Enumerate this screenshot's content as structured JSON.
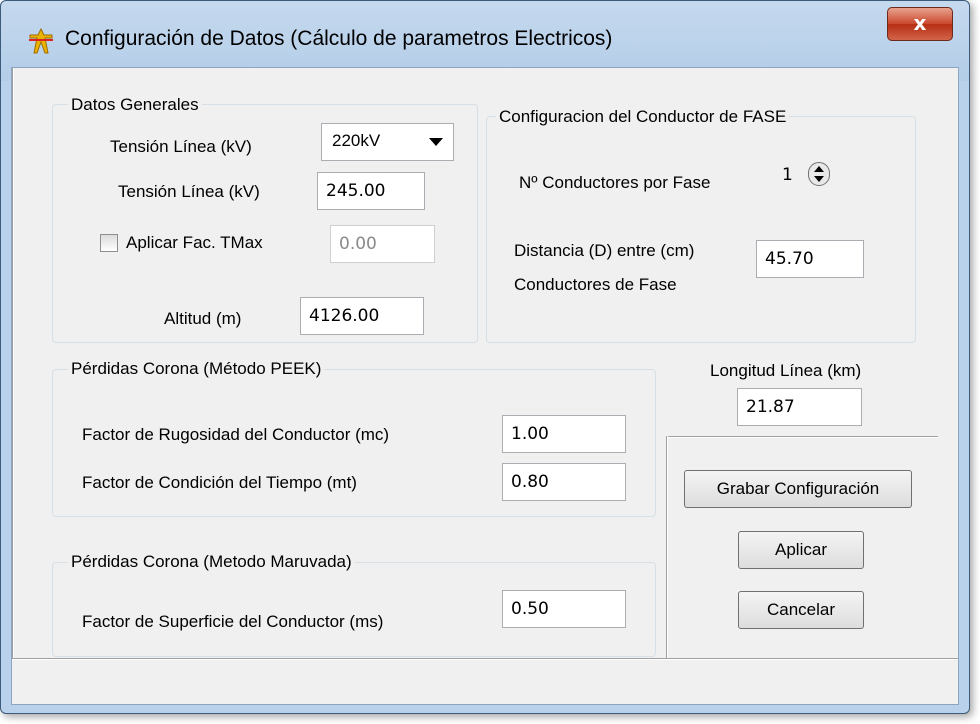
{
  "window": {
    "title": "Configuración de Datos (Cálculo de parametros Electricos)",
    "close_label": "x"
  },
  "datos_generales": {
    "title": "Datos Generales",
    "tension_label": "Tensión Línea (kV)",
    "tension_combo_value": "220kV",
    "tension_value_label": "Tensión Línea (kV)",
    "tension_value": "245.00",
    "aplicar_tmax_label": "Aplicar Fac. TMax",
    "aplicar_tmax_checked": false,
    "tmax_value": "0.00",
    "altitud_label": "Altitud (m)",
    "altitud_value": "4126.00"
  },
  "conductor_fase": {
    "title": "Configuracion del Conductor de FASE",
    "n_conductores_label": "Nº Conductores por Fase",
    "n_conductores_value": "1",
    "distancia_label": "Distancia (D)  entre (cm)",
    "distancia_label2": "Conductores de Fase",
    "distancia_value": "45.70"
  },
  "peek": {
    "title": "Pérdidas Corona (Método PEEK)",
    "rugosidad_label": "Factor de Rugosidad del Conductor (mc)",
    "rugosidad_value": "1.00",
    "tiempo_label": "Factor de Condición del Tiempo (mt)",
    "tiempo_value": "0.80"
  },
  "maruvada": {
    "title": "Pérdidas Corona (Metodo Maruvada)",
    "superficie_label": "Factor de Superficie del Conductor (ms)",
    "superficie_value": "0.50"
  },
  "longitud": {
    "label": "Longitud Línea (km)",
    "value": "21.87"
  },
  "buttons": {
    "grabar": "Grabar Configuración",
    "aplicar": "Aplicar",
    "cancelar": "Cancelar"
  },
  "icons": {
    "app_icon": "transmission-tower-icon",
    "close_icon": "close-icon"
  },
  "colors": {
    "titlebar": "#b9d1ea",
    "close_button": "#c9472b",
    "client_background": "#f0f0f0",
    "app_icon": "#e8b400"
  }
}
